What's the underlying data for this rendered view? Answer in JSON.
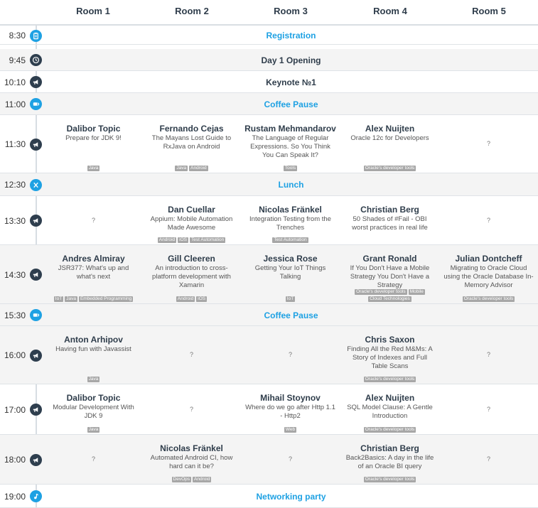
{
  "rooms": [
    "Room 1",
    "Room 2",
    "Room 3",
    "Room 4",
    "Room 5"
  ],
  "colors": {
    "accent": "#1ea1e3",
    "dark": "#2e3e4e",
    "tag": "#a7a7a7"
  },
  "slots": [
    {
      "time": "8:30",
      "icon": "clipboard-icon",
      "style": "blue",
      "general": "Registration"
    },
    {
      "time": "9:45",
      "icon": "clock-icon",
      "style": "dark",
      "general": "Day 1 Opening"
    },
    {
      "time": "10:10",
      "icon": "megaphone-icon",
      "style": "dark",
      "general": "Keynote №1"
    },
    {
      "time": "11:00",
      "icon": "coffee-cup-icon",
      "style": "blue",
      "general": "Coffee Pause"
    },
    {
      "time": "11:30",
      "icon": "megaphone-icon",
      "style": "dark",
      "talks": [
        {
          "speaker": "Dalibor Topic",
          "title": "Prepare for JDK 9!",
          "tags": [
            "Java"
          ]
        },
        {
          "speaker": "Fernando Cejas",
          "title": "The Mayans Lost Guide to RxJava on Android",
          "tags": [
            "Java",
            "Android"
          ]
        },
        {
          "speaker": "Rustam Mehmandarov",
          "title": "The Language of Regular Expressions. So You Think You Can Speak It?",
          "tags": [
            "Tools"
          ]
        },
        {
          "speaker": "Alex Nuijten",
          "title": "Oracle 12c for Developers",
          "tags": [
            "Oracle's developer tools"
          ]
        },
        {
          "speaker": "",
          "title": "?",
          "tags": []
        }
      ]
    },
    {
      "time": "12:30",
      "icon": "cutlery-icon",
      "style": "blue",
      "general": "Lunch"
    },
    {
      "time": "13:30",
      "icon": "megaphone-icon",
      "style": "dark",
      "talks": [
        {
          "speaker": "",
          "title": "?",
          "tags": []
        },
        {
          "speaker": "Dan Cuellar",
          "title": "Appium: Mobile Automation Made Awesome",
          "tags": [
            "Android",
            "iOS",
            "Test Automation"
          ]
        },
        {
          "speaker": "Nicolas Fränkel",
          "title": "Integration Testing from the Trenches",
          "tags": [
            "Test Automation"
          ]
        },
        {
          "speaker": "Christian Berg",
          "title": "50 Shades of #Fail - OBI worst practices in real life",
          "tags": []
        },
        {
          "speaker": "",
          "title": "?",
          "tags": []
        }
      ]
    },
    {
      "time": "14:30",
      "icon": "megaphone-icon",
      "style": "dark",
      "talks": [
        {
          "speaker": "Andres Almiray",
          "title": "JSR377: What's up and what's next",
          "tags": [
            "IoT",
            "Java",
            "Embedded Programming"
          ]
        },
        {
          "speaker": "Gill Cleeren",
          "title": "An introduction to cross-platform development with Xamarin",
          "tags": [
            "Android",
            "iOS"
          ]
        },
        {
          "speaker": "Jessica Rose",
          "title": "Getting Your IoT Things Talking",
          "tags": [
            "IoT"
          ]
        },
        {
          "speaker": "Grant Ronald",
          "title": "If You Don't Have a Mobile Strategy You Don't Have a Strategy",
          "tags": [
            "Oracle's developer tools",
            "Mobile",
            "Cloud Technologies"
          ]
        },
        {
          "speaker": "Julian Dontcheff",
          "title": "Migrating to Oracle Cloud using the Oracle Database In-Memory Advisor",
          "tags": [
            "Oracle's developer tools"
          ]
        }
      ]
    },
    {
      "time": "15:30",
      "icon": "coffee-cup-icon",
      "style": "blue",
      "general": "Coffee Pause"
    },
    {
      "time": "16:00",
      "icon": "megaphone-icon",
      "style": "dark",
      "talks": [
        {
          "speaker": "Anton Arhipov",
          "title": "Having fun with Javassist",
          "tags": [
            "Java"
          ]
        },
        {
          "speaker": "",
          "title": "?",
          "tags": []
        },
        {
          "speaker": "",
          "title": "?",
          "tags": []
        },
        {
          "speaker": "Chris Saxon",
          "title": "Finding All the Red M&Ms: A Story of Indexes and Full Table Scans",
          "tags": [
            "Oracle's developer tools"
          ]
        },
        {
          "speaker": "",
          "title": "?",
          "tags": []
        }
      ]
    },
    {
      "time": "17:00",
      "icon": "megaphone-icon",
      "style": "dark",
      "talks": [
        {
          "speaker": "Dalibor Topic",
          "title": "Modular Development With JDK 9",
          "tags": [
            "Java"
          ]
        },
        {
          "speaker": "",
          "title": "?",
          "tags": []
        },
        {
          "speaker": "Mihail Stoynov",
          "title": "Where do we go after Http 1.1 - Http2",
          "tags": [
            "Web"
          ]
        },
        {
          "speaker": "Alex Nuijten",
          "title": "SQL Model Clause: A Gentle Introduction",
          "tags": [
            "Oracle's developer tools"
          ]
        },
        {
          "speaker": "",
          "title": "?",
          "tags": []
        }
      ]
    },
    {
      "time": "18:00",
      "icon": "megaphone-icon",
      "style": "dark",
      "talks": [
        {
          "speaker": "",
          "title": "?",
          "tags": []
        },
        {
          "speaker": "Nicolas Fränkel",
          "title": "Automated Android CI, how hard can it be?",
          "tags": [
            "DevOps",
            "Android"
          ]
        },
        {
          "speaker": "",
          "title": "?",
          "tags": []
        },
        {
          "speaker": "Christian Berg",
          "title": "Back2Basics: A day in the life of an Oracle BI query",
          "tags": [
            "Oracle's developer tools"
          ]
        },
        {
          "speaker": "",
          "title": "?",
          "tags": []
        }
      ]
    },
    {
      "time": "19:00",
      "icon": "music-note-icon",
      "style": "blue",
      "general": "Networking party"
    }
  ]
}
